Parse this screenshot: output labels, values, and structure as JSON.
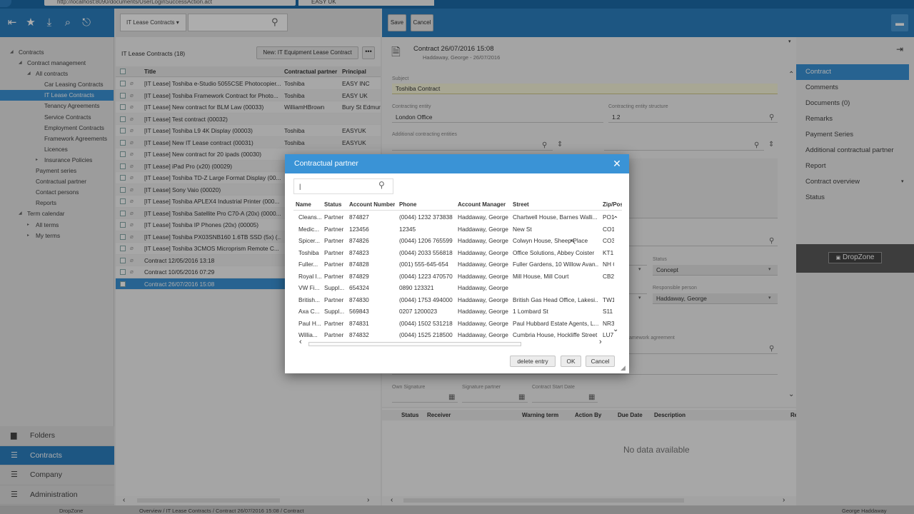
{
  "browser": {
    "url": "http://localhost:8090/documents/UserLoginSuccessAction.act",
    "tab_title": "EASY UK"
  },
  "tree": [
    {
      "label": "Contracts",
      "indent": 0,
      "arrow": "down"
    },
    {
      "label": "Contract management",
      "indent": 1,
      "arrow": "down"
    },
    {
      "label": "All contracts",
      "indent": 2,
      "arrow": "down"
    },
    {
      "label": "Car Leasing Contracts",
      "indent": 3
    },
    {
      "label": "IT Lease Contracts",
      "indent": 3,
      "selected": true
    },
    {
      "label": "Tenancy Agreements",
      "indent": 3
    },
    {
      "label": "Service Contracts",
      "indent": 3
    },
    {
      "label": "Employment Contracts",
      "indent": 3
    },
    {
      "label": "Framework Agreements",
      "indent": 3
    },
    {
      "label": "Licences",
      "indent": 3
    },
    {
      "label": "Insurance Policies",
      "indent": 3,
      "arrow": "right"
    },
    {
      "label": "Payment series",
      "indent": 2
    },
    {
      "label": "Contractual partner",
      "indent": 2
    },
    {
      "label": "Contact persons",
      "indent": 2
    },
    {
      "label": "Reports",
      "indent": 2
    },
    {
      "label": "Term calendar",
      "indent": 1,
      "arrow": "down"
    },
    {
      "label": "All terms",
      "indent": 2,
      "arrow": "right"
    },
    {
      "label": "My terms",
      "indent": 2,
      "arrow": "right"
    }
  ],
  "leftnav": [
    {
      "label": "Folders",
      "icon": "folder-icon"
    },
    {
      "label": "Contracts",
      "icon": "list-icon",
      "active": true
    },
    {
      "label": "Company",
      "icon": "list-icon"
    },
    {
      "label": "Administration",
      "icon": "list-icon"
    }
  ],
  "list": {
    "dropdown": "IT Lease Contracts",
    "count": "IT Lease Contracts (18)",
    "new_button": "New: IT Equipment Lease Contract",
    "more_button": "•••",
    "headers": {
      "title": "Title",
      "partner": "Contractual partner",
      "principal": "Principal"
    },
    "rows": [
      {
        "title": "[IT Lease] Toshiba e-Studio 5055CSE Photocopier...",
        "partner": "Toshiba",
        "principal": "EASY INC"
      },
      {
        "title": "[IT Lease] Toshiba Framework Contract for Photo...",
        "partner": "Toshiba",
        "principal": "EASY UK"
      },
      {
        "title": "[IT Lease] New contract for BLM Law (00033)",
        "partner": "WilliamHBrown",
        "principal": "Bury St Edmur"
      },
      {
        "title": "[IT Lease] Test contract (00032)",
        "partner": "",
        "principal": ""
      },
      {
        "title": "[IT Lease] Toshiba L9 4K Display (00003)",
        "partner": "Toshiba",
        "principal": "EASYUK"
      },
      {
        "title": "[IT Lease] New IT Lease contract (00031)",
        "partner": "Toshiba",
        "principal": "EASYUK"
      },
      {
        "title": "[IT Lease] New contract for 20 ipads (00030)",
        "partner": "",
        "principal": ""
      },
      {
        "title": "[IT Lease] iPad Pro (x20) (00029)",
        "partner": "",
        "principal": ""
      },
      {
        "title": "[IT Lease] Toshiba TD-Z Large Format Display (00...",
        "partner": "",
        "principal": ""
      },
      {
        "title": "[IT Lease] Sony Vaio (00020)",
        "partner": "",
        "principal": ""
      },
      {
        "title": "[IT Lease] Toshiba APLEX4 Industrial Printer (000...",
        "partner": "",
        "principal": ""
      },
      {
        "title": "[IT Lease] Toshiba Satellite Pro C70-A (20x) (0000...",
        "partner": "",
        "principal": ""
      },
      {
        "title": "[IT Lease] Toshiba IP Phones (20x) (00005)",
        "partner": "",
        "principal": ""
      },
      {
        "title": "[IT Lease] Toshiba PX03SNB160 1.6TB SSD (5x) (...",
        "partner": "",
        "principal": ""
      },
      {
        "title": "[IT Lease] Toshiba 3CMOS Microprism Remote C...",
        "partner": "",
        "principal": ""
      },
      {
        "title": "Contract 12/05/2016 13:18",
        "partner": "",
        "principal": ""
      },
      {
        "title": "Contract 10/05/2016 07:29",
        "partner": "",
        "principal": ""
      },
      {
        "title": "Contract 26/07/2016 15:08",
        "partner": "",
        "principal": "",
        "selected": true
      }
    ]
  },
  "detail": {
    "save": "Save",
    "cancel": "Cancel",
    "title": "Contract 26/07/2016 15:08",
    "subtitle": "Haddaway, George - 26/07/2016",
    "fields": {
      "subject_label": "Subject",
      "subject": "Toshiba Contract",
      "entity_label": "Contracting entity",
      "entity": "London Office",
      "structure_label": "Contracting entity structure",
      "structure": "1.2",
      "additional_label": "Additional contracting entities",
      "status_label": "Status",
      "status": "Concept",
      "responsible_label": "Responsible person",
      "responsible": "Haddaway, George",
      "framework_label": "amework agreement",
      "own_signature": "Own Signature",
      "signature_partner": "Signature partner",
      "start_date": "Contract Start Date"
    },
    "tasks": {
      "headers": [
        "Status",
        "Receiver",
        "Warning term",
        "Action By",
        "Due Date",
        "Description",
        "Re"
      ],
      "empty": "No data available"
    }
  },
  "right_nav": [
    {
      "label": "Contract",
      "active": true
    },
    {
      "label": "Comments"
    },
    {
      "label": "Documents (0)"
    },
    {
      "label": "Remarks"
    },
    {
      "label": "Payment Series"
    },
    {
      "label": "Additional contractual partner"
    },
    {
      "label": "Report"
    },
    {
      "label": "Contract overview"
    },
    {
      "label": "Status"
    }
  ],
  "dropzone": "DropZone",
  "status_bar": {
    "left": "DropZone",
    "breadcrumb": "Overview  /  IT Lease Contracts  /  Contract 26/07/2016 15:08  /  Contract",
    "user": "George Haddaway"
  },
  "modal": {
    "title": "Contractual partner",
    "search_value": "|",
    "headers": [
      "Name",
      "Status",
      "Account Number",
      "Phone",
      "Account Manager",
      "Street",
      "Zip/Pos"
    ],
    "rows": [
      [
        "Cleans...",
        "Partner",
        "874827",
        "(0044) 1232 373838",
        "Haddaway, George",
        "Chartwell House, Barnes Walli...",
        "PO1"
      ],
      [
        "Medic...",
        "Partner",
        "123456",
        "12345",
        "Haddaway, George",
        "New St",
        "CO1"
      ],
      [
        "Spicer...",
        "Partner",
        "874826",
        "(0044) 1206 765599",
        "Haddaway, George",
        "Colwyn House, Sheep    Place",
        "CO3"
      ],
      [
        "Toshiba",
        "Partner",
        "874823",
        "(0044) 2033 556818",
        "Haddaway, George",
        "Office Solutions, Abbey Coister",
        "KT1"
      ],
      [
        "Fuller...",
        "Partner",
        "874828",
        "(001) 555-645-654",
        "Haddaway, George",
        "Fuller Gardens, 10 Willow Avan...",
        "NH C"
      ],
      [
        "Royal I...",
        "Partner",
        "874829",
        "(0044) 1223 470570",
        "Haddaway, George",
        "Mill House, Mill Court",
        "CB2"
      ],
      [
        "VW Fi...",
        "Suppl...",
        "654324",
        "0890 123321",
        "Haddaway, George",
        "",
        ""
      ],
      [
        "British...",
        "Partner",
        "874830",
        "(0044) 1753 494000",
        "Haddaway, George",
        "British Gas Head Office, Lakesi...",
        "TW1"
      ],
      [
        "Axa C...",
        "Suppl...",
        "569843",
        "0207 1200023",
        "Haddaway, George",
        "1 Lombard St",
        "S11"
      ],
      [
        "Paul H...",
        "Partner",
        "874831",
        "(0044) 1502 531218",
        "Haddaway, George",
        "Paul Hubbard Estate Agents, L...",
        "NR3"
      ],
      [
        "Willia...",
        "Partner",
        "874832",
        "(0044) 1525 218500",
        "Haddaway, George",
        "Cumbria House, Hockliffe Street",
        "LU7"
      ]
    ],
    "delete_button": "delete entry",
    "ok_button": "OK",
    "cancel_button": "Cancel"
  }
}
